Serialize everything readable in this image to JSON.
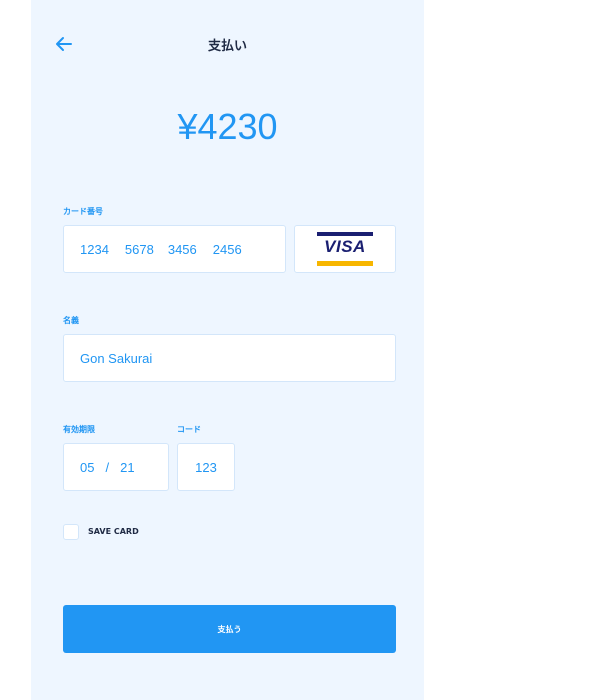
{
  "header": {
    "title": "支払い",
    "back_icon": "arrow-left-icon"
  },
  "payment": {
    "amount": "¥4230"
  },
  "card_number": {
    "label": "カード番号",
    "groups": [
      "1234",
      "5678",
      "3456",
      "2456"
    ],
    "brand": "VISA"
  },
  "holder": {
    "label": "名義",
    "value": "Gon Sakurai"
  },
  "expiry": {
    "label": "有効期限",
    "month": "05",
    "separator": "/",
    "year": "21"
  },
  "code": {
    "label": "コード",
    "value": "123"
  },
  "save_card": {
    "label": "SAVE CARD",
    "checked": false
  },
  "actions": {
    "pay_label": "支払う"
  },
  "colors": {
    "accent": "#2196f3",
    "panel_background": "#eef6ff",
    "visa_blue": "#1a1f71",
    "visa_gold": "#f7b600"
  }
}
